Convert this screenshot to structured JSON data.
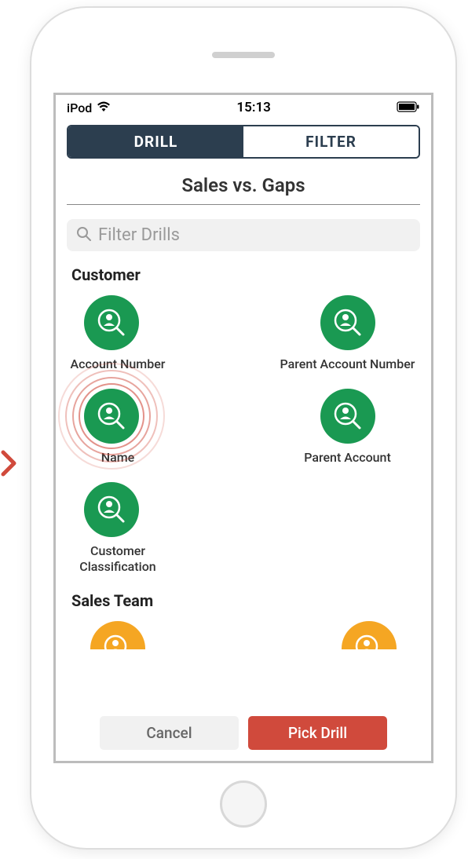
{
  "status": {
    "device": "iPod",
    "time": "15:13"
  },
  "tabs": {
    "drill": "DRILL",
    "filter": "FILTER"
  },
  "page_title": "Sales vs. Gaps",
  "search": {
    "placeholder": "Filter Drills"
  },
  "sections": {
    "customer": {
      "header": "Customer",
      "items": [
        {
          "label": "Account Number"
        },
        {
          "label": "Parent Account Number"
        },
        {
          "label": "Name"
        },
        {
          "label": "Parent Account"
        },
        {
          "label": "Customer Classification"
        }
      ]
    },
    "sales_team": {
      "header": "Sales Team"
    }
  },
  "buttons": {
    "cancel": "Cancel",
    "pick": "Pick Drill"
  },
  "colors": {
    "dark_blue": "#2c3e4f",
    "green": "#1a9952",
    "orange": "#f5a623",
    "red": "#d04a3c"
  }
}
